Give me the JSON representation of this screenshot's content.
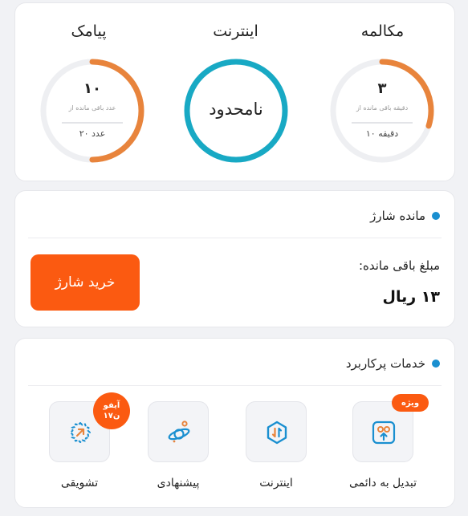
{
  "usage": {
    "sms": {
      "title": "پیامک",
      "remaining": "۱۰",
      "remaining_label": "عدد باقی مانده از",
      "total": "۲۰ عدد",
      "fraction": 0.5
    },
    "internet": {
      "title": "اینترنت",
      "value": "نامحدود",
      "fraction": 1
    },
    "call": {
      "title": "مکالمه",
      "remaining": "۳",
      "remaining_label": "دقیقه باقی مانده از",
      "total": "۱۰ دقیقه",
      "fraction": 0.3
    },
    "colors": {
      "orange": "#e8843c",
      "teal": "#18a9c4",
      "track": "#eeeff2"
    }
  },
  "charge": {
    "title": "مانده شارژ",
    "remaining_label": "مبلغ باقی مانده:",
    "amount": "۱۳ ریال",
    "buy_label": "خرید شارژ",
    "button_color": "#fb5a11"
  },
  "services": {
    "title": "خدمات پرکاربرد",
    "items": [
      {
        "label": "تبدیل به دائمی",
        "icon": "sim-upgrade-icon",
        "badge": "ویژه"
      },
      {
        "label": "اینترنت",
        "icon": "internet-hex-icon"
      },
      {
        "label": "پیشنهادی",
        "icon": "planet-icon"
      },
      {
        "label": "تشویقی",
        "icon": "reward-icon",
        "badge_line1": "آیفو",
        "badge_line2": "۱۷ن"
      }
    ]
  }
}
